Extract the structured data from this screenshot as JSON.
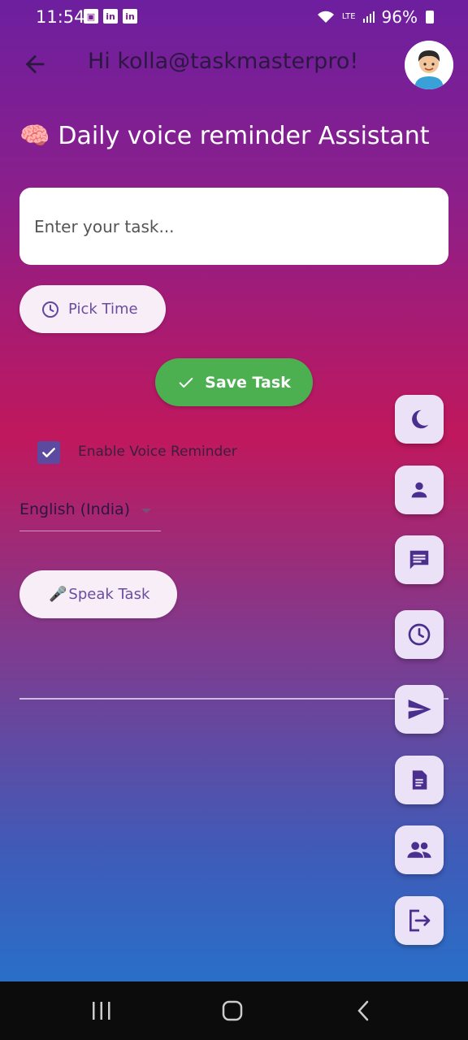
{
  "status_bar": {
    "time": "11:54",
    "battery": "96%",
    "network": "LTE",
    "icons": [
      "gallery-icon",
      "linkedin-icon",
      "linkedin-icon",
      "wifi-icon",
      "volte-icon",
      "signal-icon",
      "battery-icon"
    ]
  },
  "header": {
    "greeting": "Hi kolla@taskmasterpro!",
    "back_icon": "arrow-left-icon",
    "avatar_icon": "avatar-icon"
  },
  "title": {
    "emoji": "🧠",
    "text": "Daily voice reminder Assistant"
  },
  "task_input": {
    "placeholder": "Enter your task...",
    "value": ""
  },
  "pick_time": {
    "label": "Pick Time",
    "icon": "clock-icon"
  },
  "save_task": {
    "label": "Save Task",
    "icon": "check-icon",
    "color": "#4caf50"
  },
  "voice_reminder": {
    "label": "Enable Voice Reminder",
    "checked": true
  },
  "language": {
    "selected": "English (India)"
  },
  "speak_task": {
    "emoji": "🎤",
    "label": "Speak Task"
  },
  "fab_buttons": [
    {
      "icon": "moon-icon"
    },
    {
      "icon": "person-icon"
    },
    {
      "icon": "chat-icon"
    },
    {
      "icon": "clock-icon"
    },
    {
      "icon": "send-icon"
    },
    {
      "icon": "document-icon"
    },
    {
      "icon": "group-icon"
    },
    {
      "icon": "logout-icon"
    }
  ],
  "colors": {
    "accent": "#5b4aa0",
    "fab_bg": "#ece2f7",
    "gradient_top": "#6d1f9f",
    "gradient_mid": "#c0185d",
    "gradient_bottom": "#1f78d0"
  }
}
